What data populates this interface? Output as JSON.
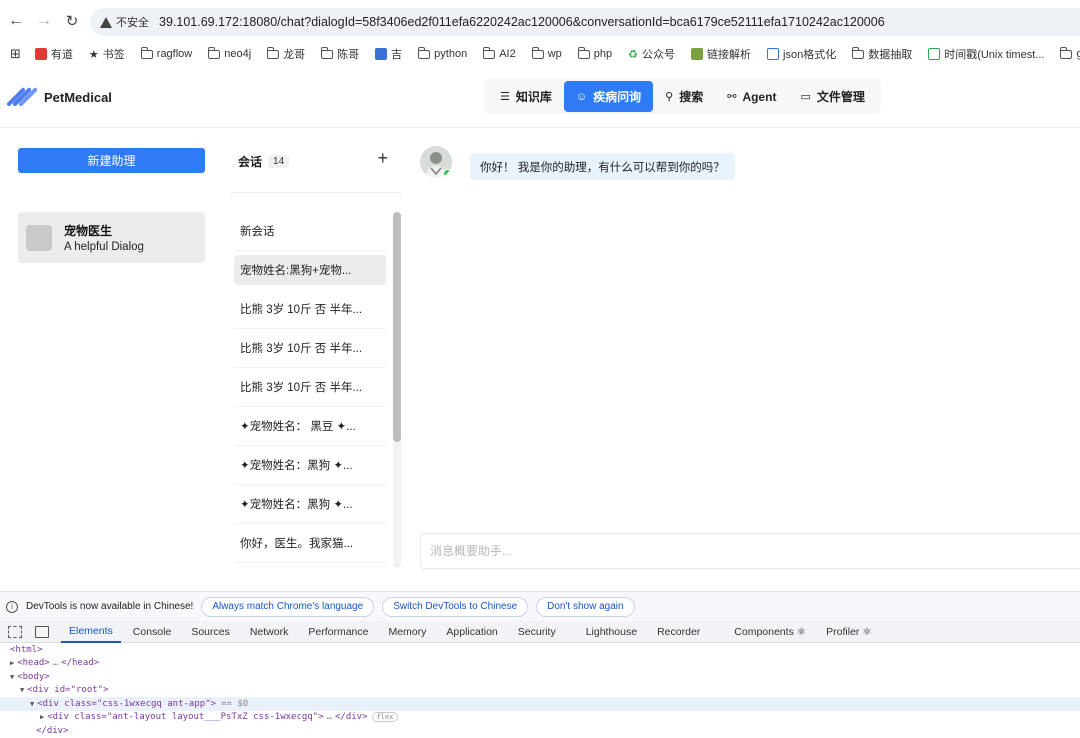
{
  "browser": {
    "insecure_label": "不安全",
    "url": "39.101.69.172:18080/chat?dialogId=58f3406ed2f011efa6220242ac120006&conversationId=bca6179ce52111efa1710242ac120006",
    "bookmarks": [
      "有道",
      "书签",
      "ragflow",
      "neo4j",
      "龙哥",
      "陈哥",
      "吉",
      "python",
      "AI2",
      "wp",
      "php",
      "公众号",
      "链接解析",
      "json格式化",
      "数据抽取",
      "时间戳(Unix timest...",
      "guaji"
    ]
  },
  "app": {
    "brand": "PetMedical",
    "nav": [
      {
        "label": "知识库",
        "icon": "database-icon"
      },
      {
        "label": "疾病问询",
        "icon": "chat-icon",
        "active": true
      },
      {
        "label": "搜索",
        "icon": "search-icon"
      },
      {
        "label": "Agent",
        "icon": "agent-icon"
      },
      {
        "label": "文件管理",
        "icon": "folder-icon"
      }
    ],
    "accent": "#2f7bf5"
  },
  "assistants": {
    "new_button": "新建助理",
    "items": [
      {
        "name": "宠物医生",
        "description": "A helpful Dialog"
      }
    ]
  },
  "conversations": {
    "title": "会话",
    "count": "14",
    "items": [
      "新会话",
      "宠物姓名:黑狗+宠物...",
      "比熊 3岁 10斤 否 半年...",
      "比熊 3岁 10斤 否 半年...",
      "比熊 3岁 10斤 否 半年...",
      "✦宠物姓名：  黑豆 ✦...",
      "✦宠物姓名：黑狗 ✦...",
      "✦宠物姓名：黑狗 ✦...",
      "你好，医生。我家猫..."
    ]
  },
  "chat": {
    "greeting": "你好！ 我是你的助理，有什么可以帮到你的吗？",
    "input_placeholder": "消息概要助手..."
  },
  "devtools": {
    "notice": "DevTools is now available in Chinese!",
    "buttons": [
      "Always match Chrome's language",
      "Switch DevTools to Chinese",
      "Don't show again"
    ],
    "tabs": [
      "Elements",
      "Console",
      "Sources",
      "Network",
      "Performance",
      "Memory",
      "Application",
      "Security",
      "Lighthouse",
      "Recorder",
      "Components ⚛",
      "Profiler ⚛"
    ],
    "dom": {
      "html": "<html>",
      "head": "<head>",
      "head_close": "</head>",
      "body": "<body>",
      "root_div": "<div id=\"root\">",
      "app_div": "<div class=\"css-1wxecgq ant-app\">",
      "app_ref": "== $0",
      "layout_div": "<div class=\"ant-layout layout___PsTxZ css-1wxecgq\">",
      "layout_close": "</div>",
      "flex_badge": "flex",
      "div_close": "</div>"
    }
  }
}
